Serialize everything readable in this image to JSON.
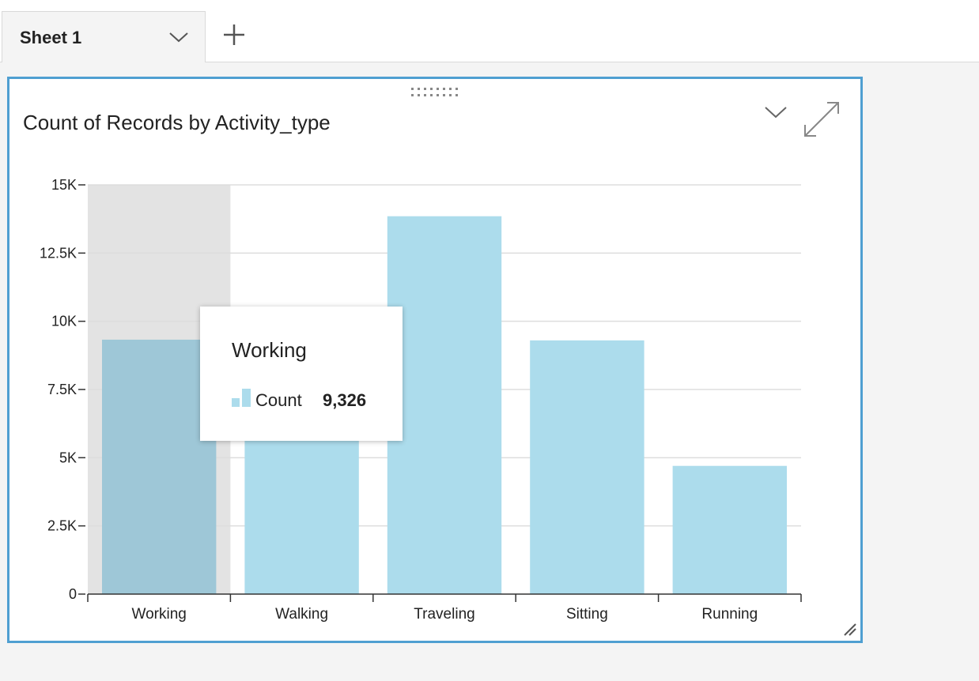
{
  "sheet_tabs": [
    {
      "label": "Sheet 1",
      "active": true
    }
  ],
  "add_sheet_icon": "plus-icon",
  "visual": {
    "title": "Count of Records by Activity_type",
    "menu_icon": "chevron-down-icon",
    "expand_icon": "expand-icon",
    "border_color": "#4f9fd1"
  },
  "tooltip": {
    "category": "Working",
    "measure_label": "Count",
    "measure_value": "9,326"
  },
  "colors": {
    "bar": "#acdcec",
    "bar_highlight": "#9ec7d7",
    "highlight_band": "#e3e3e3",
    "gridline": "#dddddd"
  },
  "chart_data": {
    "type": "bar",
    "title": "Count of Records by Activity_type",
    "categories": [
      "Working",
      "Walking",
      "Traveling",
      "Sitting",
      "Running"
    ],
    "series": [
      {
        "name": "Count",
        "values": [
          9326,
          8500,
          13850,
          9300,
          4700
        ]
      }
    ],
    "ylim": [
      0,
      15000
    ],
    "yticks": [
      0,
      2500,
      5000,
      7500,
      10000,
      12500,
      15000
    ],
    "ytick_labels": [
      "0",
      "2.5K",
      "5K",
      "7.5K",
      "10K",
      "12.5K",
      "15K"
    ],
    "xlabel": "",
    "ylabel": "",
    "grid": true,
    "highlighted_category": "Working"
  }
}
